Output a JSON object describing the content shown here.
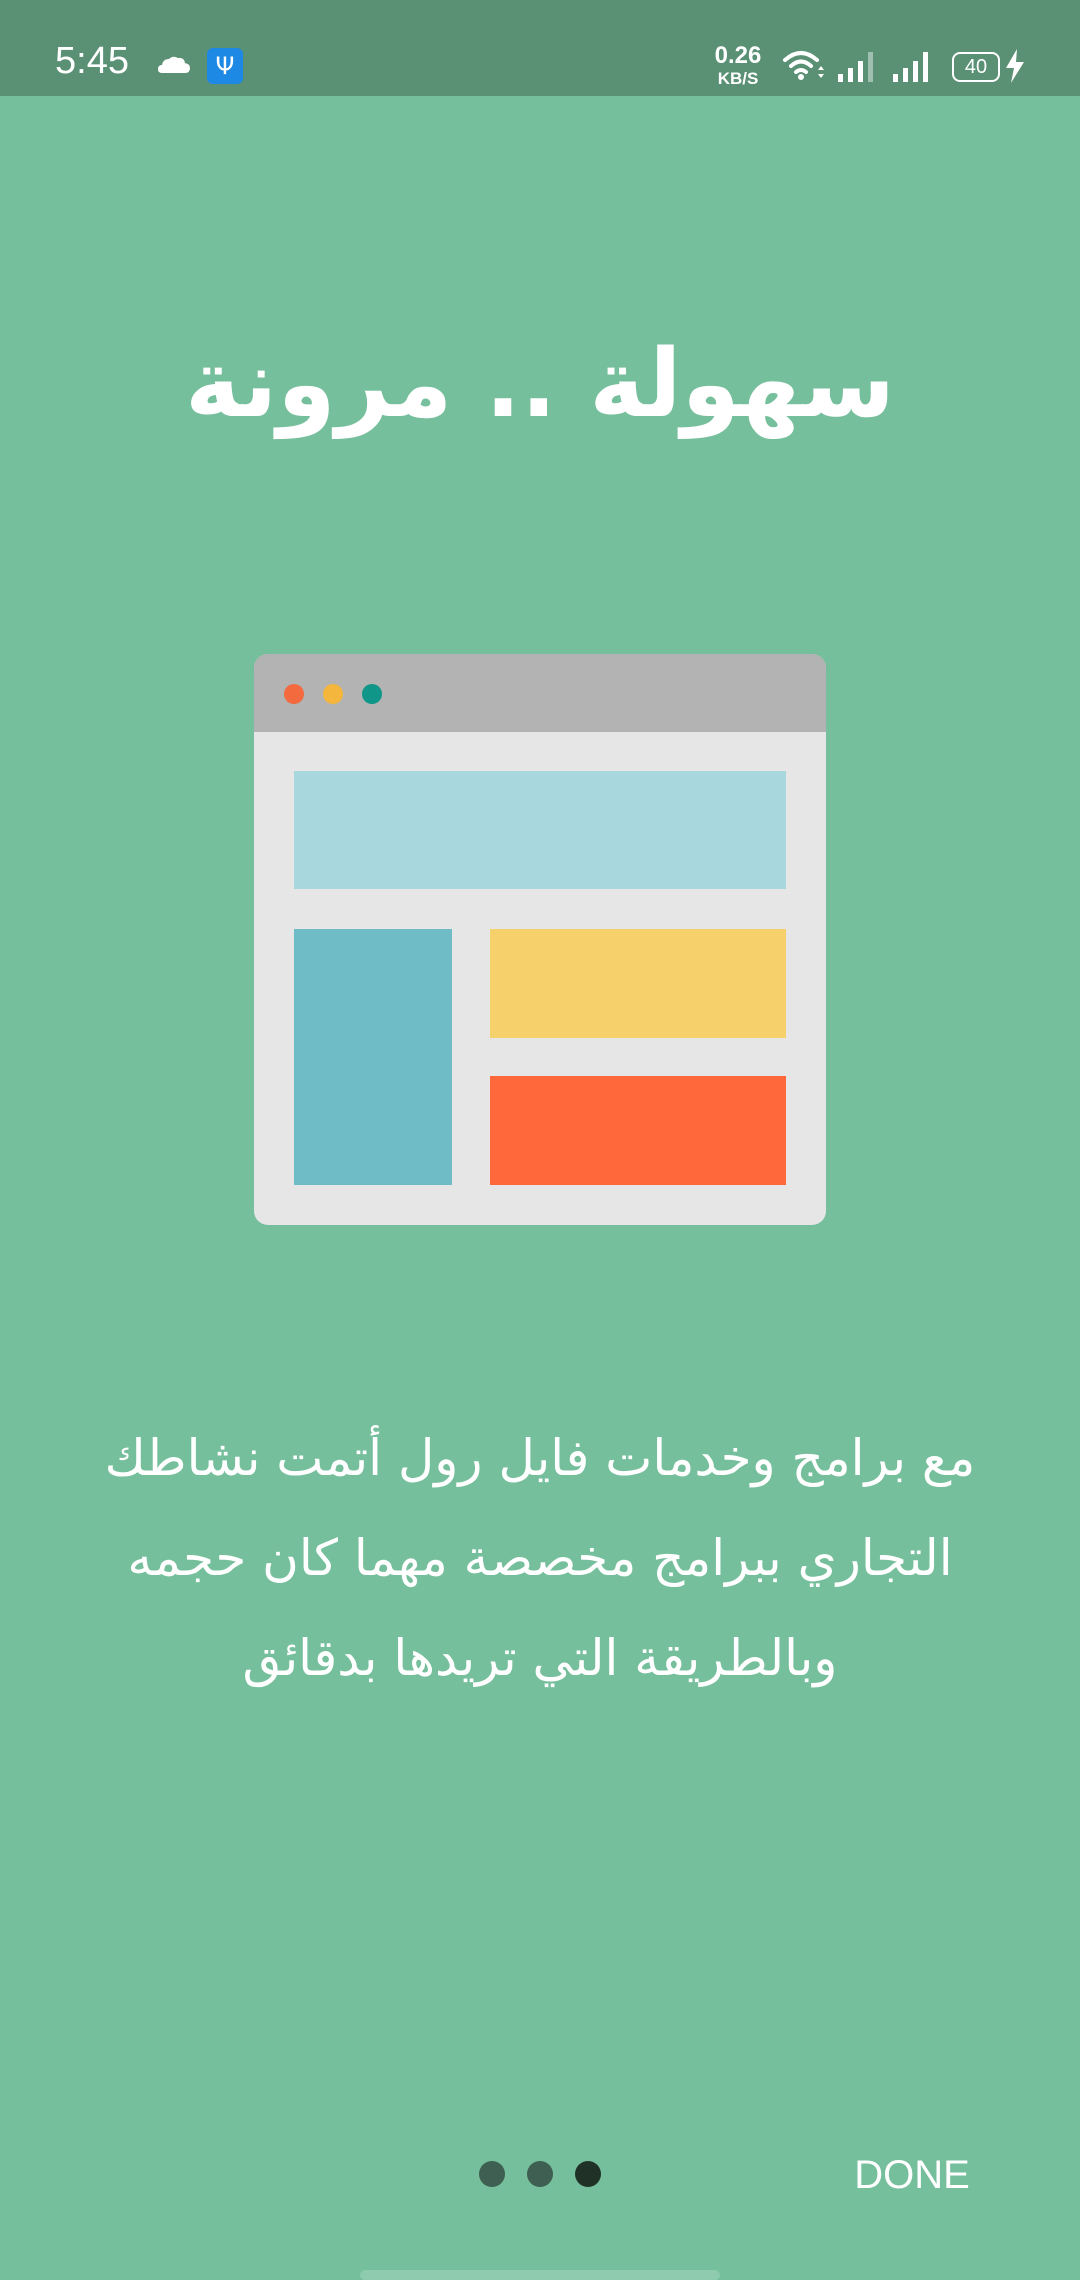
{
  "status_bar": {
    "time": "5:45",
    "net_speed_value": "0.26",
    "net_speed_unit": "KB/S",
    "battery_level": "40",
    "icons": [
      "cloud-icon",
      "usb-debug-icon",
      "wifi-icon",
      "signal-icon",
      "signal-icon",
      "battery-icon",
      "charging-icon"
    ]
  },
  "onboarding": {
    "title": "سهولة .. مرونة",
    "description_lines": [
      "مع برامج وخدمات فايل رول أتمت نشاطك",
      "التجاري ببرامج مخصصة مهما كان حجمه",
      "وبالطريقة التي تريدها بدقائق"
    ],
    "illustration": "browser-window-illustration",
    "page_count": 3,
    "current_page": 3,
    "done_label": "DONE"
  },
  "colors": {
    "background": "#76bf9c",
    "status_bar": "#5a9175",
    "window_body": "#e6e6e6",
    "window_titlebar": "#b3b3b3",
    "dot_red": "#f26a3d",
    "dot_yellow": "#f5b63e",
    "dot_teal": "#0f9688",
    "block_header": "#a8d8dd",
    "block_sidebar": "#6fbcc7",
    "block_yellow": "#f5d06b",
    "block_orange": "#ff683a",
    "pager_inactive": "#3e5f51",
    "pager_active": "#203228"
  }
}
